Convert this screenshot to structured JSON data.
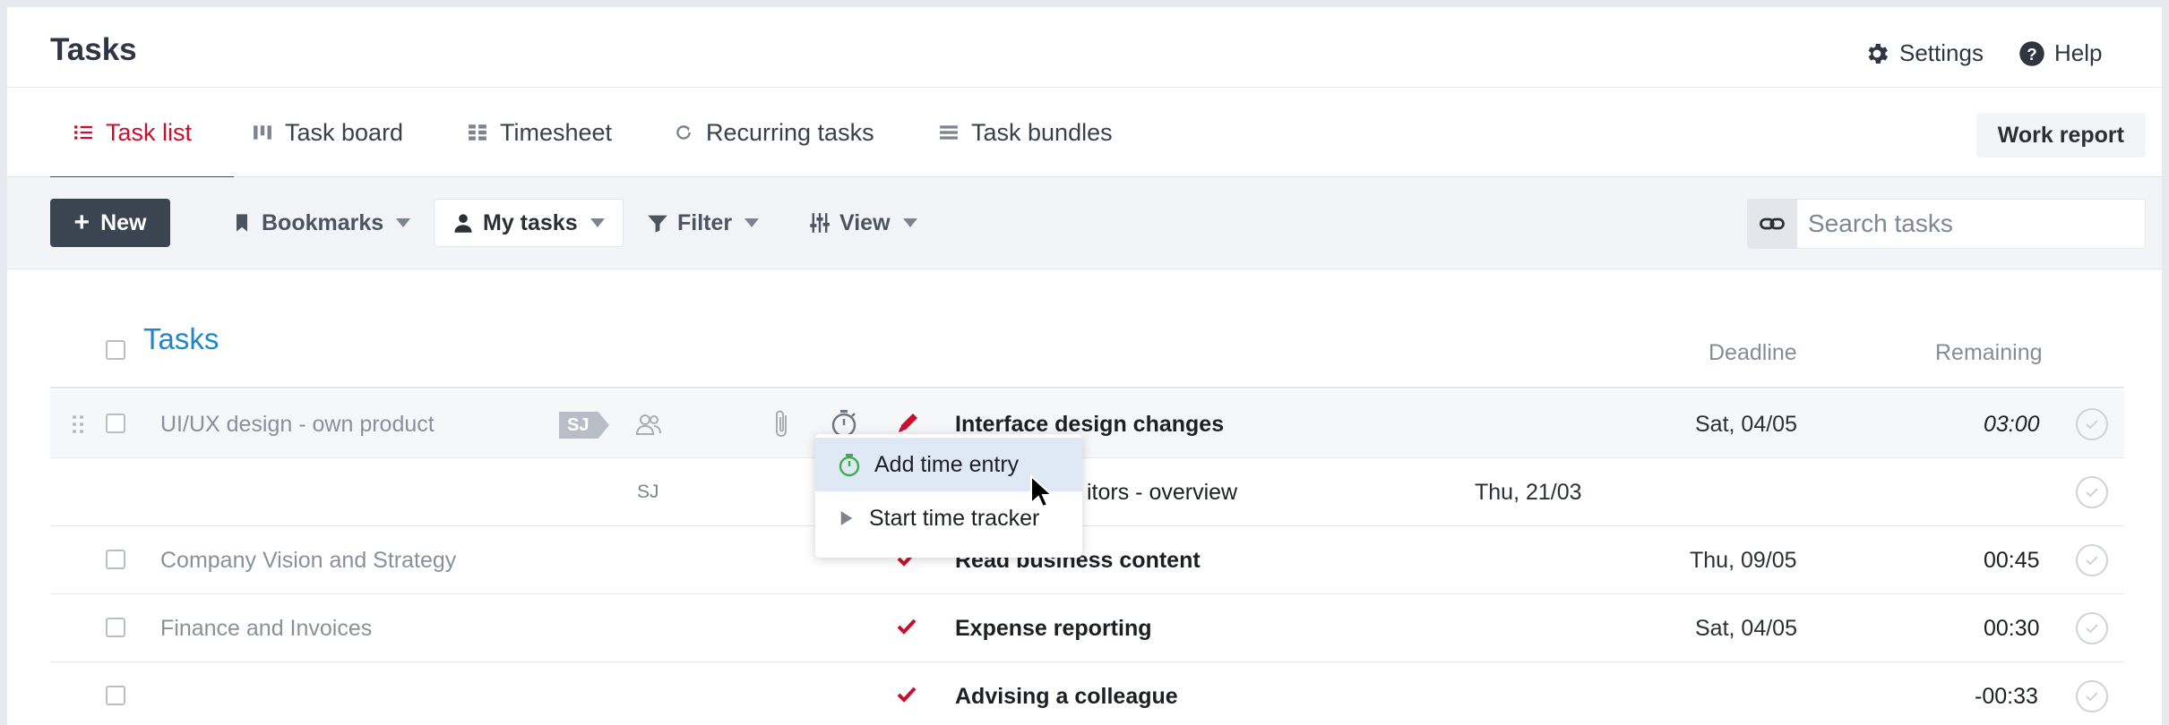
{
  "header": {
    "title": "Tasks",
    "settings_label": "Settings",
    "help_label": "Help"
  },
  "tabs": [
    {
      "label": "Task list",
      "icon": "list-icon",
      "active": true
    },
    {
      "label": "Task board",
      "icon": "board-icon",
      "active": false
    },
    {
      "label": "Timesheet",
      "icon": "timesheet-icon",
      "active": false
    },
    {
      "label": "Recurring tasks",
      "icon": "refresh-icon",
      "active": false
    },
    {
      "label": "Task bundles",
      "icon": "bundle-icon",
      "active": false
    }
  ],
  "work_report_label": "Work report",
  "toolbar": {
    "new_label": "New",
    "bookmarks_label": "Bookmarks",
    "my_tasks_label": "My tasks",
    "filter_label": "Filter",
    "view_label": "View",
    "search_placeholder": "Search tasks"
  },
  "table": {
    "section_title": "Tasks",
    "columns": {
      "deadline": "Deadline",
      "remaining": "Remaining"
    },
    "rows": [
      {
        "project": "UI/UX design - own product",
        "badge": "SJ",
        "task": "Interface design changes",
        "deadline": "Sat, 04/05",
        "remaining": "03:00",
        "status_icon": "pencil-icon"
      },
      {
        "project": "",
        "initials": "SJ",
        "task": "itors - overview",
        "deadline": "Thu, 21/03",
        "remaining": "",
        "status_icon": ""
      },
      {
        "project": "Company Vision and Strategy",
        "task": "Read business content",
        "deadline": "Thu, 09/05",
        "remaining": "00:45",
        "status_icon": "check-icon"
      },
      {
        "project": "Finance and Invoices",
        "task": "Expense reporting",
        "deadline": "Sat, 04/05",
        "remaining": "00:30",
        "status_icon": "check-icon"
      },
      {
        "project": "",
        "task": "Advising a colleague",
        "deadline": "",
        "remaining": "-00:33",
        "status_icon": "check-icon"
      }
    ]
  },
  "dropdown": {
    "items": [
      {
        "label": "Add time entry",
        "icon": "stopwatch-icon"
      },
      {
        "label": "Start time tracker",
        "icon": "play-icon"
      }
    ]
  },
  "colors": {
    "accent": "#c8102e",
    "link": "#1f86c8",
    "dark_button": "#3b4552",
    "timer_green": "#3fae49"
  }
}
